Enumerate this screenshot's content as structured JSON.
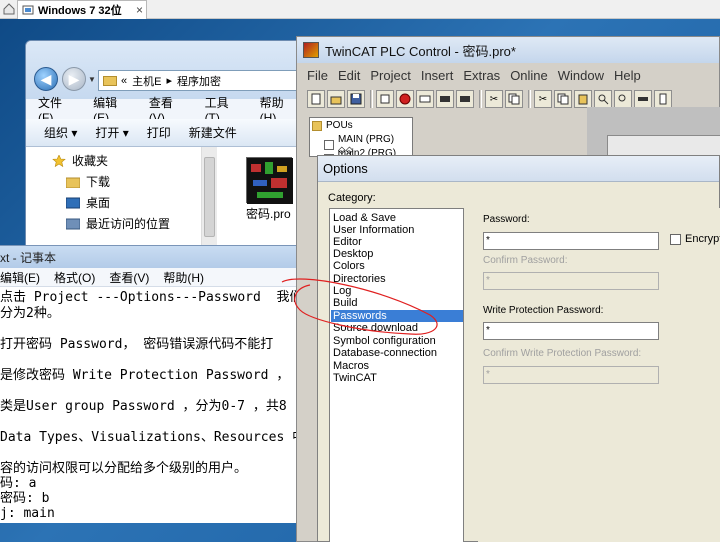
{
  "vm": {
    "tab_label": "Windows 7  32位",
    "close_glyph": "×"
  },
  "explorer": {
    "nav_back": "◀",
    "nav_forward": "▶",
    "address": {
      "chevron": "«",
      "crumb1": "主机E",
      "sep": "▸",
      "crumb2": "程序加密"
    },
    "menu": [
      "文件(F)",
      "编辑(E)",
      "查看(V)",
      "工具(T)",
      "帮助(H)"
    ],
    "toolbar": {
      "organize": "组织 ▾",
      "open": "打开 ▾",
      "print": "打印",
      "new_folder": "新建文件"
    },
    "sidebar": [
      "收藏夹",
      "下载",
      "桌面",
      "最近访问的位置"
    ],
    "file_name": "密码.pro"
  },
  "notepad": {
    "title": "xt - 记事本",
    "menu": [
      "编辑(E)",
      "格式(O)",
      "查看(V)",
      "帮助(H)"
    ],
    "lines": [
      "点击 Project ---Options---Password  我们",
      "分为2种。",
      "",
      "打开密码 Password， 密码错误源代码不能打",
      "",
      "是修改密码 Write Protection Password ，",
      "",
      "类是User group Password ，分为0-7 ，共8",
      "",
      "Data Types、Visualizations、Resources 中",
      "",
      "容的访问权限可以分配给多个级别的用户。",
      "码: a",
      "密码: b",
      "j: main"
    ]
  },
  "twincat": {
    "title": "TwinCAT PLC Control - 密码.pro*",
    "menu": [
      "File",
      "Edit",
      "Project",
      "Insert",
      "Extras",
      "Online",
      "Window",
      "Help"
    ],
    "pous": {
      "root": "POUs",
      "items": [
        "MAIN (PRG) ◇◇",
        "main2 (PRG) ◇◇"
      ]
    }
  },
  "options": {
    "title": "Options",
    "category_label": "Category:",
    "categories": [
      "Load & Save",
      "User Information",
      "Editor",
      "Desktop",
      "Colors",
      "Directories",
      "Log",
      "Build",
      "Passwords",
      "Source download",
      "Symbol configuration",
      "Database-connection",
      "Macros",
      "TwinCAT"
    ],
    "selected_category": "Passwords",
    "password_label": "Password:",
    "password_value": "*",
    "confirm_password_label": "Confirm Password:",
    "confirm_password_value": "*",
    "encrypt_label": "Encrypt",
    "write_protect_label": "Write Protection Password:",
    "write_protect_value": "*",
    "confirm_write_protect_label": "Confirm Write Protection Password:",
    "confirm_write_protect_value": "*"
  },
  "colors": {
    "selection": "#3a7ed6",
    "annotation": "#e02020",
    "disabled_text": "#a0a0a0"
  }
}
